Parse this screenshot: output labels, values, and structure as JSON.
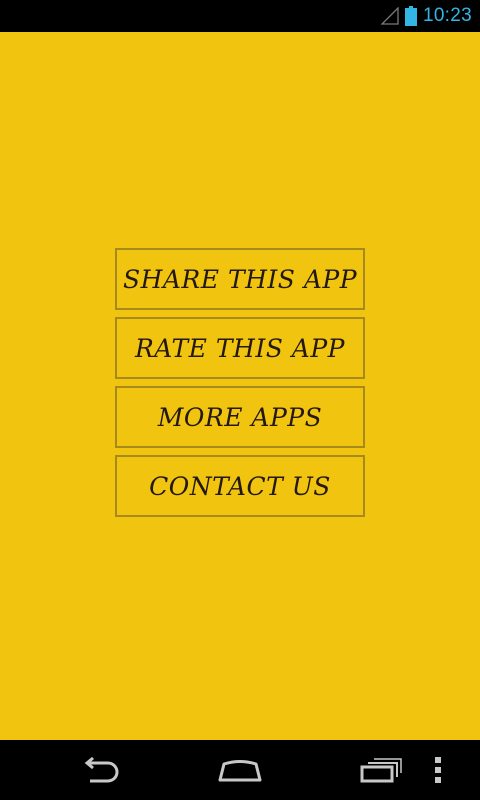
{
  "status_bar": {
    "time": "10:23",
    "icons": [
      "signal-icon",
      "battery-icon"
    ],
    "accent_color": "#33b5e5"
  },
  "app": {
    "background_color": "#f1c40f",
    "menu": [
      {
        "label": "SHARE THIS APP"
      },
      {
        "label": "RATE THIS APP"
      },
      {
        "label": "MORE APPS"
      },
      {
        "label": "CONTACT US"
      }
    ]
  },
  "navigation_bar": {
    "icons": [
      "back-icon",
      "home-icon",
      "recent-apps-icon",
      "overflow-menu-icon"
    ]
  }
}
